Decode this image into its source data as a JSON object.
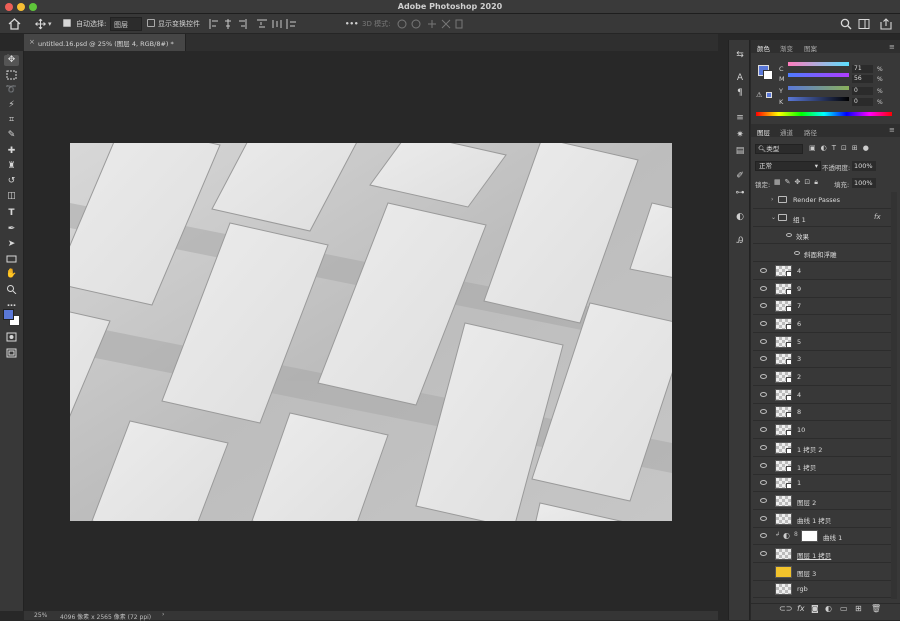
{
  "app": {
    "title": "Adobe Photoshop 2020"
  },
  "options_bar": {
    "auto_select_label": "自动选择:",
    "auto_select_value": "图层",
    "show_transform_label": "显示变换控件",
    "mode_3d_label": "3D 模式:"
  },
  "document": {
    "tab_title": "untitled.16.psd @ 25% (图层 4, RGB/8#) *",
    "zoom": "25%",
    "dimensions": "4096 像素 x 2565 像素 (72 ppi)"
  },
  "color_panel": {
    "tabs": [
      "颜色",
      "渐变",
      "图案"
    ],
    "channels": [
      {
        "label": "C",
        "value": "71",
        "unit": "%"
      },
      {
        "label": "M",
        "value": "56",
        "unit": "%"
      },
      {
        "label": "Y",
        "value": "0",
        "unit": "%"
      },
      {
        "label": "K",
        "value": "0",
        "unit": "%"
      }
    ],
    "foreground_color": "#5a78d8"
  },
  "layers_panel": {
    "tabs": [
      "图层",
      "通道",
      "路径"
    ],
    "filter_kind": "类型",
    "blend_mode": "正常",
    "opacity_label": "不透明度:",
    "opacity_value": "100%",
    "lock_label": "锁定:",
    "fill_label": "填充:",
    "fill_value": "100%",
    "layers": [
      {
        "name": "Render Passes",
        "kind": "group"
      },
      {
        "name": "组 1",
        "kind": "group",
        "fx": "fx"
      },
      {
        "name": "效果",
        "kind": "effect"
      },
      {
        "name": "斜面和浮雕",
        "kind": "effect"
      },
      {
        "name": "4",
        "kind": "smart"
      },
      {
        "name": "9",
        "kind": "smart"
      },
      {
        "name": "7",
        "kind": "smart"
      },
      {
        "name": "6",
        "kind": "smart"
      },
      {
        "name": "5",
        "kind": "smart"
      },
      {
        "name": "3",
        "kind": "smart"
      },
      {
        "name": "2",
        "kind": "smart"
      },
      {
        "name": "4",
        "kind": "smart"
      },
      {
        "name": "8",
        "kind": "smart"
      },
      {
        "name": "10",
        "kind": "smart"
      },
      {
        "name": "1 拷贝 2",
        "kind": "smart"
      },
      {
        "name": "1 拷贝",
        "kind": "smart"
      },
      {
        "name": "1",
        "kind": "smart"
      },
      {
        "name": "图层 2",
        "kind": "pixel"
      },
      {
        "name": "曲线 1 拷贝",
        "kind": "pixel"
      },
      {
        "name": "曲线 1",
        "kind": "adjust"
      },
      {
        "name": "图层 1 拷贝",
        "kind": "pixel"
      },
      {
        "name": "图层 3",
        "kind": "yellow"
      },
      {
        "name": "rgb",
        "kind": "pixel"
      },
      {
        "name": "图层 4",
        "kind": "white"
      }
    ]
  }
}
